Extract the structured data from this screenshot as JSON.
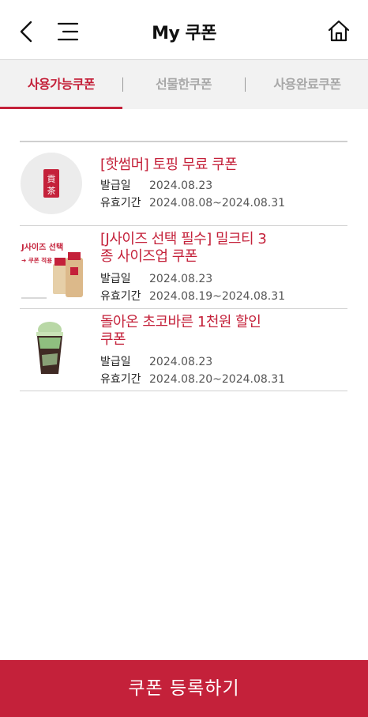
{
  "header": {
    "title": "My 쿠폰",
    "back_icon": "chevron-left-icon",
    "menu_icon": "menu-icon",
    "home_icon": "home-icon"
  },
  "tabs": [
    {
      "label": "사용가능쿠폰",
      "active": true
    },
    {
      "label": "선물한쿠폰",
      "active": false
    },
    {
      "label": "사용완료쿠폰",
      "active": false
    }
  ],
  "coupons": [
    {
      "title": "[핫썸머] 토핑 무료 쿠폰",
      "issued_label": "발급일",
      "issued": "2024.08.23",
      "valid_label": "유효기간",
      "valid": "2024.08.08~2024.08.31",
      "thumb_logo_text": "貢茶"
    },
    {
      "title_line1": "[J사이즈 선택 필수] 밀크티 3",
      "title_line2": "종 사이즈업 쿠폰",
      "issued_label": "발급일",
      "issued": "2024.08.23",
      "valid_label": "유효기간",
      "valid": "2024.08.19~2024.08.31",
      "thumb_text1": "J사이즈 선택",
      "thumb_text2": "➜ 쿠폰 적용"
    },
    {
      "title_line1": "돌아온 초코바른 1천원 할인",
      "title_line2": "쿠폰",
      "issued_label": "발급일",
      "issued": "2024.08.23",
      "valid_label": "유효기간",
      "valid": "2024.08.20~2024.08.31"
    }
  ],
  "register_button": "쿠폰 등록하기",
  "colors": {
    "accent": "#c4213a",
    "tab_background": "#f2f2f2"
  }
}
